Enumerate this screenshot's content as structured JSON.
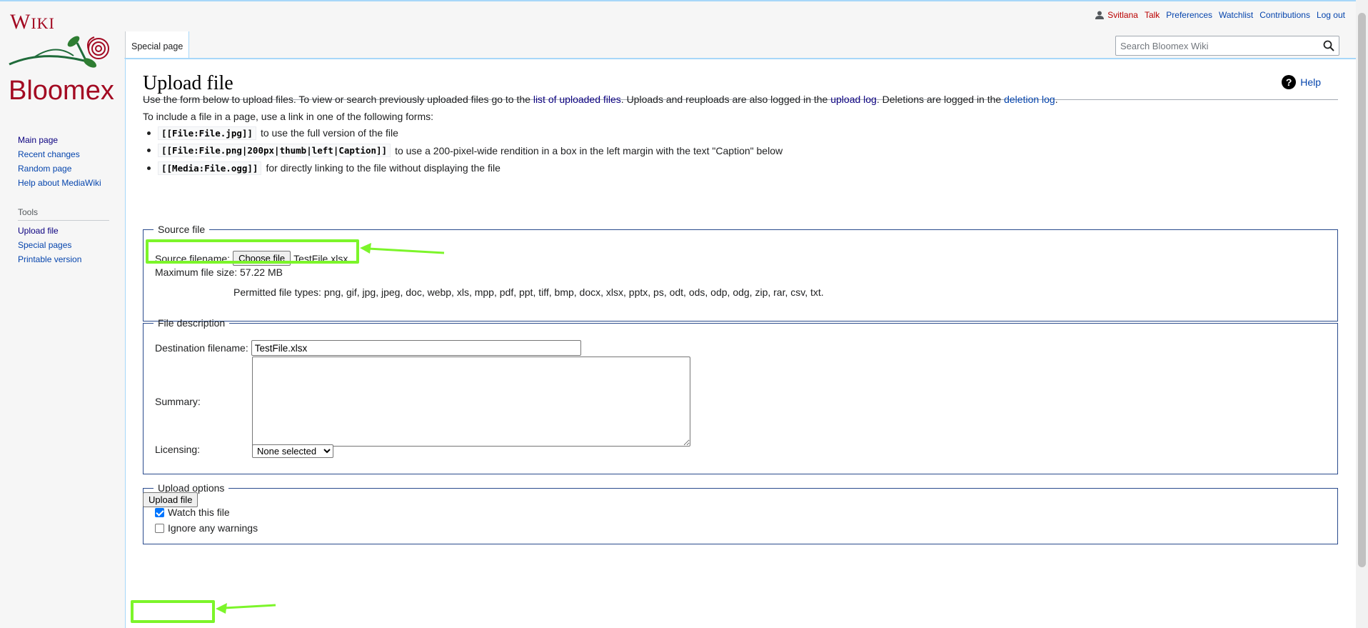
{
  "logo": {
    "wiki_cap": "W",
    "wiki_rest": "IKI",
    "brand": "Bloomex"
  },
  "colors": {
    "link": "#0645ad",
    "visited": "#0b0080",
    "user_link": "#ba0000",
    "highlight": "#7cf52a",
    "fieldset_border": "#2a4b8d"
  },
  "personal": {
    "user_icon": "user-icon",
    "username": "Svitlana",
    "talk": "Talk",
    "preferences": "Preferences",
    "watchlist": "Watchlist",
    "contributions": "Contributions",
    "logout": "Log out"
  },
  "tabs": {
    "special": "Special page"
  },
  "search": {
    "placeholder": "Search Bloomex Wiki",
    "icon": "search-icon"
  },
  "sidebar": {
    "navigation": [
      "Main page",
      "Recent changes",
      "Random page",
      "Help about MediaWiki"
    ],
    "tools_heading": "Tools",
    "tools": [
      "Upload file",
      "Special pages",
      "Printable version"
    ]
  },
  "page": {
    "title": "Upload file",
    "help": "Help",
    "intro": {
      "part1": "Use the form below to upload files. To view or search previously uploaded files go to the ",
      "link1": "list of uploaded files",
      "part2": ". Uploads and reuploads are also logged in the ",
      "link2": "upload log",
      "part3": ". Deletions are logged in the ",
      "link3": "deletion log",
      "part4": "."
    },
    "include_text": "To include a file in a page, use a link in one of the following forms:",
    "forms": [
      {
        "code": "[[File:File.jpg]]",
        "desc": "to use the full version of the file"
      },
      {
        "code": "[[File:File.png|200px|thumb|left|Caption]]",
        "desc": "to use a 200-pixel-wide rendition in a box in the left margin with the text \"Caption\" below"
      },
      {
        "code": "[[Media:File.ogg]]",
        "desc": "for directly linking to the file without displaying the file"
      }
    ]
  },
  "source_file": {
    "legend": "Source file",
    "filename_label": "Source filename:",
    "choose_button": "Choose file",
    "chosen_file": "TestFile.xlsx",
    "max_size": "Maximum file size: 57.22 MB",
    "permitted": "Permitted file types: png, gif, jpg, jpeg, doc, webp, xls, mpp, pdf, ppt, tiff, bmp, docx, xlsx, pptx, ps, odt, ods, odp, odg, zip, rar, csv, txt."
  },
  "file_description": {
    "legend": "File description",
    "dest_label": "Destination filename:",
    "dest_value": "TestFile.xlsx",
    "summary_label": "Summary:",
    "summary_value": "",
    "licensing_label": "Licensing:",
    "licensing_selected": "None selected"
  },
  "upload_options": {
    "legend": "Upload options",
    "watch_label": "Watch this file",
    "watch_checked": true,
    "ignore_label": "Ignore any warnings",
    "ignore_checked": false
  },
  "upload_button": "Upload file"
}
